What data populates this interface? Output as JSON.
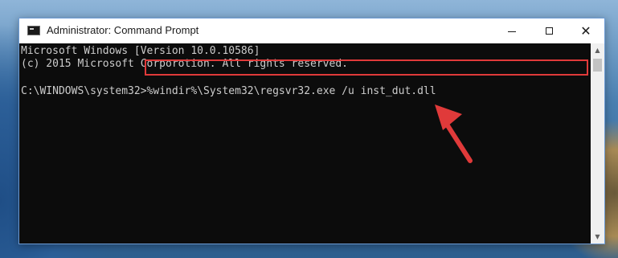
{
  "window": {
    "title": "Administrator: Command Prompt",
    "minimize_label": "—",
    "maximize_label": "☐",
    "close_label": "✕"
  },
  "console": {
    "lines": [
      "Microsoft Windows [Version 10.0.10586]",
      "(c) 2015 Microsoft Corporotion. All rights reserved.",
      "",
      "C:\\WINDOWS\\system32>%windir%\\System32\\regsvr32.exe /u inst_dut.dll"
    ],
    "prompt": "C:\\WINDOWS\\system32>",
    "command": "%windir%\\System32\\regsvr32.exe /u inst_dut.dll"
  },
  "annotation": {
    "highlight_color": "#e03a3a",
    "arrow_color": "#e03a3a"
  },
  "icons": {
    "app": "cmd-icon",
    "scroll_up": "scroll-up-icon",
    "scroll_down": "scroll-down-icon"
  }
}
